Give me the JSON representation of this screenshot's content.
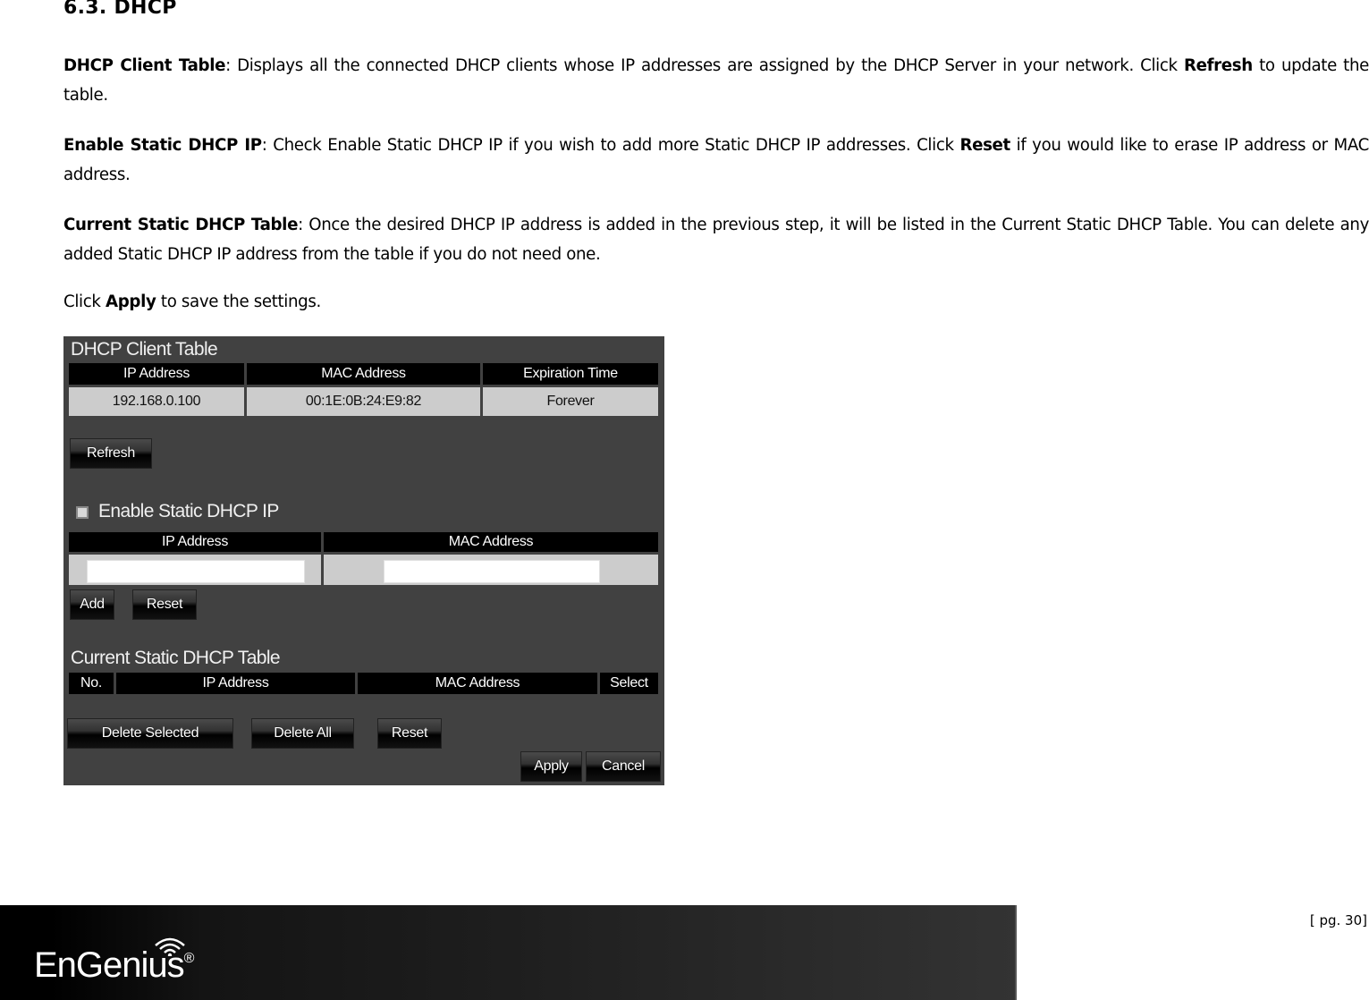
{
  "heading": "6.3.  DHCP",
  "paragraphs": {
    "p1": {
      "bold1": "DHCP Client Table",
      "text1": ": Displays all the connected DHCP clients whose IP addresses are assigned by the DHCP Server in your network. Click ",
      "bold2": "Refresh",
      "text2": " to update the table."
    },
    "p2": {
      "bold1": "Enable Static DHCP IP",
      "text1": ": Check Enable Static DHCP IP if you wish to add more Static DHCP IP addresses. Click ",
      "bold2": "Reset",
      "text2": " if you would like to erase IP address or MAC address."
    },
    "p3": {
      "bold1": "Current Static DHCP Table",
      "text1": ": Once the desired DHCP IP address is added in the previous step, it will be listed in the Current Static DHCP Table. You can delete any added Static DHCP IP address from the table if you do not need one."
    },
    "p4": {
      "text1": "Click ",
      "bold1": "Apply",
      "text2": " to save the settings."
    }
  },
  "panel": {
    "client_table": {
      "title": "DHCP Client Table",
      "columns": [
        "IP Address",
        "MAC Address",
        "Expiration Time"
      ],
      "rows": [
        [
          "192.168.0.100",
          "00:1E:0B:24:E9:82",
          "Forever"
        ]
      ],
      "refresh_label": "Refresh"
    },
    "static": {
      "checkbox_label": "Enable Static DHCP IP",
      "checked": false,
      "columns": [
        "IP Address",
        "MAC Address"
      ],
      "ip_value": "",
      "mac_value": "",
      "add_label": "Add",
      "reset_label": "Reset"
    },
    "current_table": {
      "title": "Current Static DHCP Table",
      "columns": [
        "No.",
        "IP Address",
        "MAC Address",
        "Select"
      ],
      "delete_selected_label": "Delete Selected",
      "delete_all_label": "Delete All",
      "reset_label": "Reset",
      "apply_label": "Apply",
      "cancel_label": "Cancel"
    }
  },
  "footer": {
    "brand": "EnGenius",
    "registered": "®",
    "page_label": "[ pg. 30]"
  }
}
